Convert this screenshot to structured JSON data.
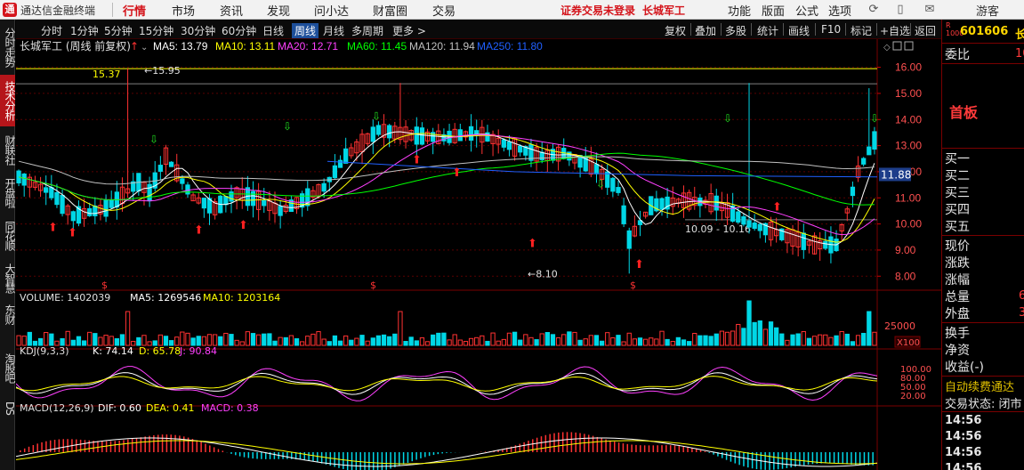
{
  "app": {
    "name": "通达信金融终端",
    "logo_char": "通"
  },
  "top_menu": [
    {
      "label": "行情",
      "active": true
    },
    {
      "label": "市场",
      "active": false
    },
    {
      "label": "资讯",
      "active": false
    },
    {
      "label": "发现",
      "active": false
    },
    {
      "label": "问小达",
      "active": false
    },
    {
      "label": "财富圈",
      "active": false
    },
    {
      "label": "交易",
      "active": false
    }
  ],
  "status": {
    "trade_login": "证券交易未登录",
    "stock_name_tag": "长城军工"
  },
  "right_menu": [
    "功能",
    "版面",
    "公式",
    "选项"
  ],
  "guest_label": "游客",
  "side_tabs": [
    "分时走势",
    "技术分析",
    "财联社",
    "开盘啦",
    "同花顺",
    "大智慧",
    "东财",
    "淘股吧",
    "DS"
  ],
  "side_tab_active": 1,
  "periods": [
    "分时",
    "1分钟",
    "5分钟",
    "15分钟",
    "30分钟",
    "60分钟",
    "日线",
    "周线",
    "月线",
    "多周期",
    "更多 >"
  ],
  "period_active": 7,
  "tools": [
    "复权",
    "叠加",
    "多股",
    "统计",
    "画线",
    "F10",
    "标记",
    "+自选",
    "返回"
  ],
  "main_chart": {
    "title": "长城军工 (周线 前复权)",
    "ma_labels": [
      {
        "text": "MA5: 13.79",
        "color": "#ffffff"
      },
      {
        "text": "MA10: 13.11",
        "color": "#ffff00"
      },
      {
        "text": "MA20: 12.71",
        "color": "#ff40ff"
      },
      {
        "text": "MA60: 11.45",
        "color": "#00ff00"
      },
      {
        "text": "MA120: 11.94",
        "color": "#c0c0c0"
      },
      {
        "text": "MA250: 11.80",
        "color": "#2060ff"
      }
    ],
    "hline_left_label": "15.37",
    "high_label": "15.95",
    "low_label": "8.10",
    "range_label": "10.09 - 10.16",
    "current_price_tag": "11.88",
    "price_ticks": [
      "16.00",
      "15.00",
      "14.00",
      "13.00",
      "12.00",
      "11.00",
      "10.00",
      "9.00",
      "8.00"
    ]
  },
  "volume_chart": {
    "label": "VOLUME: 1402039",
    "ma5": "MA5: 1269546",
    "ma10": "MA10: 1203164",
    "tick_high": "25000",
    "unit": "X100"
  },
  "kdj_chart": {
    "label": "KDJ(9,3,3)",
    "k": "K: 74.14",
    "d": "D: 65.78",
    "j": "J: 90.84",
    "ticks": [
      "100.00",
      "80.00",
      "50.00",
      "20.00"
    ]
  },
  "macd_chart": {
    "label": "MACD(12,26,9)",
    "dif": "DIF: 0.60",
    "dea": "DEA: 0.41",
    "macd": "MACD: 0.38"
  },
  "right_panel": {
    "code": "601606",
    "code_suffix": "长",
    "rows": [
      "委比",
      "首板",
      "买一",
      "买二",
      "买三",
      "买四",
      "买五",
      "现价",
      "涨跌",
      "涨幅",
      "总量",
      "外盘",
      "换手",
      "净资",
      "收益(-)",
      "自动续费通达",
      "交易状态: 闭市"
    ],
    "weibi_val": "10",
    "total_val": "6",
    "outer_val": "3",
    "times": [
      "14:56",
      "14:56",
      "14:56",
      "14:56"
    ]
  },
  "colors": {
    "up": "#ff3232",
    "down": "#00d7e6",
    "ma5": "#ffffff",
    "ma10": "#ffff00",
    "ma20": "#ff40ff",
    "ma60": "#00ff00",
    "ma120": "#c0c0c0",
    "ma250": "#2060ff",
    "grid": "#5a0000"
  }
}
